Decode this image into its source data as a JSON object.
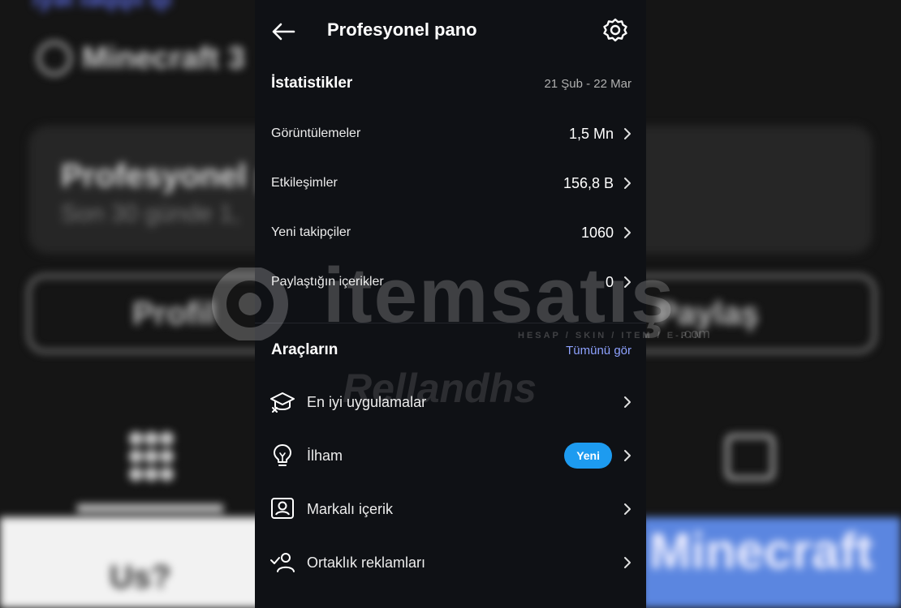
{
  "background": {
    "top_link": "ıyəi ıəqqıı qı",
    "title": "Minecraft 3",
    "card_title": "Profesyonel p",
    "card_subtitle": "Son 30 günde 1,",
    "button_left": "Profil",
    "button_right": "Paylaş",
    "bottom_left_text": "Us?",
    "bottom_right_text": "Minecraft"
  },
  "header": {
    "title": "Profesyonel pano",
    "back_icon": "arrow-left-icon",
    "settings_icon": "gear-icon"
  },
  "stats": {
    "title": "İstatistikler",
    "date_range": "21 Şub - 22 Mar",
    "rows": [
      {
        "label": "Görüntülemeler",
        "value": "1,5 Mn"
      },
      {
        "label": "Etkileşimler",
        "value": "156,8 B"
      },
      {
        "label": "Yeni takipçiler",
        "value": "1060"
      },
      {
        "label": "Paylaştığın içerikler",
        "value": "0"
      }
    ]
  },
  "tools": {
    "title": "Araçların",
    "see_all": "Tümünü gör",
    "items": [
      {
        "label": "En iyi uygulamalar",
        "icon": "graduation-cap-icon"
      },
      {
        "label": "İlham",
        "icon": "lightbulb-icon",
        "badge": "Yeni"
      },
      {
        "label": "Markalı içerik",
        "icon": "branded-content-icon"
      },
      {
        "label": "Ortaklık reklamları",
        "icon": "partnership-person-check-icon"
      }
    ]
  },
  "watermark": {
    "brand": "itemsatış",
    "tagline": "HESAP / SKIN / ITEM / E-PIN",
    "suffix": ".com",
    "username": "Rellandhs"
  },
  "colors": {
    "panel_bg": "#0f1115",
    "accent_link": "#8ea2ff",
    "badge": "#1d9bf0"
  }
}
